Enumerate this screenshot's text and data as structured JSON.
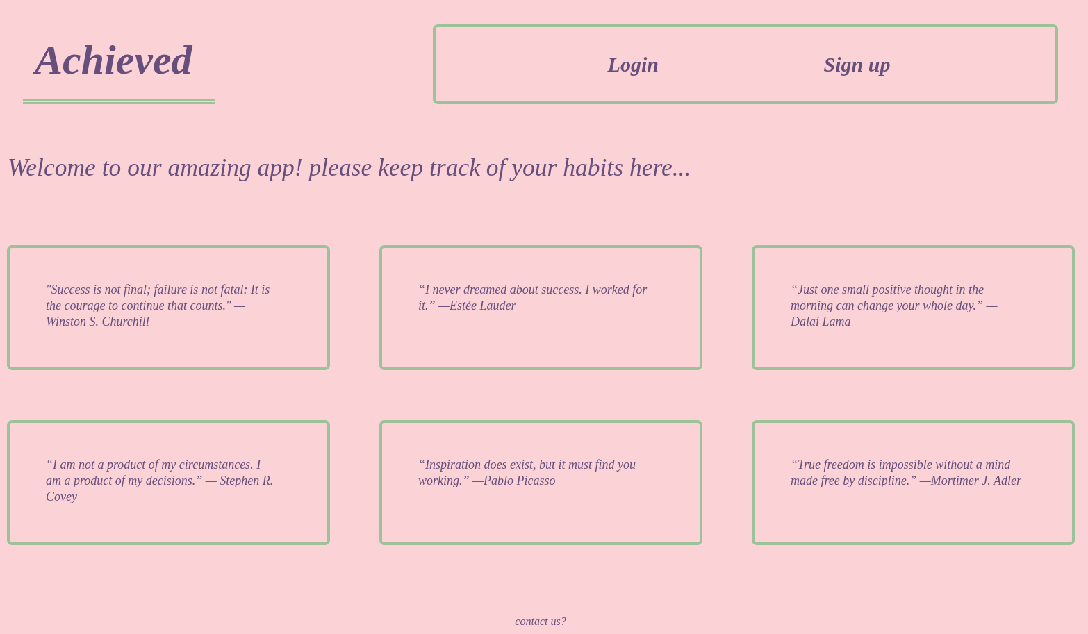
{
  "header": {
    "logo": "Achieved",
    "nav": [
      {
        "label": "Login"
      },
      {
        "label": "Sign up"
      }
    ]
  },
  "welcome": "Welcome to our amazing app! please keep track of your habits here...",
  "quotes": [
    "\"Success is not final; failure is not fatal: It is the courage to continue that counts.\" — Winston S. Churchill",
    "“I never dreamed about success. I worked for it.” —Estée Lauder",
    "“Just one small positive thought in the morning can change your whole day.” — Dalai Lama",
    "“I am not a product of my circumstances. I am a product of my decisions.” — Stephen R. Covey",
    "“Inspiration does exist, but it must find you working.” —Pablo Picasso",
    "“True freedom is impossible without a mind made free by discipline.” —Mortimer J. Adler"
  ],
  "footer": {
    "link": "contact us?"
  }
}
